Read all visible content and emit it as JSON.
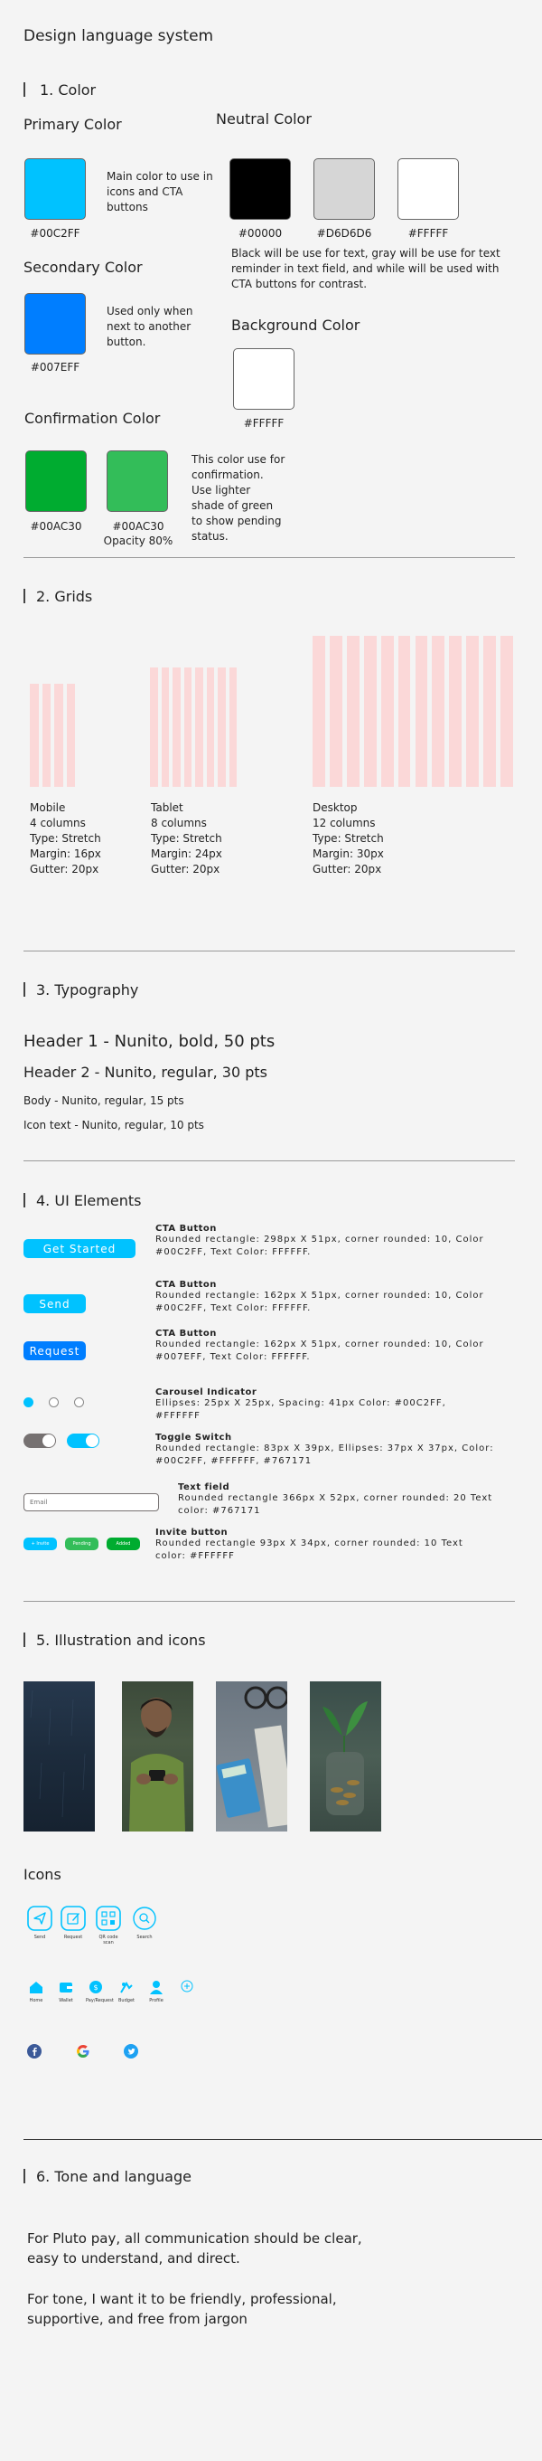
{
  "page_title": "Design language system",
  "color": {
    "section": "1. Color",
    "primary": {
      "title": "Primary Color",
      "hex": "#00C2FF",
      "desc": "Main color to use in icons and CTA buttons",
      "color": "#00C2FF"
    },
    "secondary": {
      "title": "Secondary Color",
      "hex": "#007EFF",
      "desc": "Used only when next to another button.",
      "color": "#007EFF"
    },
    "confirmation": {
      "title": "Confirmation Color",
      "hex1": "#00AC30",
      "hex2": "#00AC30",
      "opacity": "Opacity 80%",
      "desc": "This color use for confirmation. Use lighter shade of green to show pending status.",
      "color1": "#00AC30",
      "color2": "#33BD59"
    },
    "neutral": {
      "title": "Neutral Color",
      "hex1": "#00000",
      "hex2": "#D6D6D6",
      "hex3": "#FFFFF",
      "desc": "Black will be use for text, gray will be use for text reminder in text field, and while will be used with CTA buttons for contrast.",
      "c1": "#000000",
      "c2": "#D6D6D6",
      "c3": "#FFFFFF"
    },
    "background": {
      "title": "Background Color",
      "hex": "#FFFFF",
      "color": "#FFFFFF"
    }
  },
  "grids": {
    "section": "2. Grids",
    "mobile": {
      "name": "Mobile",
      "columns": "4 columns",
      "type": "Type: Stretch",
      "margin": "Margin: 16px",
      "gutter": "Gutter: 20px",
      "count": 4
    },
    "tablet": {
      "name": "Tablet",
      "columns": "8 columns",
      "type": "Type: Stretch",
      "margin": "Margin: 24px",
      "gutter": "Gutter: 20px",
      "count": 8
    },
    "desktop": {
      "name": "Desktop",
      "columns": "12 columns",
      "type": "Type: Stretch",
      "margin": "Margin: 30px",
      "gutter": "Gutter: 20px",
      "count": 12
    }
  },
  "typography": {
    "section": "3. Typography",
    "h1": "Header 1 - Nunito, bold, 50 pts",
    "h2": "Header 2 - Nunito, regular, 30 pts",
    "body": "Body - Nunito, regular, 15 pts",
    "icon": "Icon text - Nunito, regular, 10 pts"
  },
  "ui": {
    "section": "4. UI Elements",
    "cta1": {
      "label": "Get Started",
      "title": "CTA Button",
      "desc": "Rounded rectangle: 298px X 51px, corner rounded: 10, Color #00C2FF, Text Color: FFFFFF."
    },
    "cta2": {
      "label": "Send",
      "title": "CTA Button",
      "desc": "Rounded rectangle: 162px X 51px, corner rounded: 10, Color #00C2FF, Text Color: FFFFFF."
    },
    "cta3": {
      "label": "Request",
      "title": "CTA Button",
      "desc": "Rounded rectangle: 162px X 51px, corner rounded: 10, Color #007EFF, Text Color: FFFFFF."
    },
    "carousel": {
      "title": "Carousel Indicator",
      "desc": "Ellipses: 25px X 25px, Spacing: 41px Color: #00C2FF, #FFFFFF"
    },
    "toggle": {
      "title": "Toggle Switch",
      "desc": "Rounded rectangle: 83px X 39px, Ellipses: 37px X 37px, Color: #00C2FF, #FFFFFF, #767171"
    },
    "textfield": {
      "title": "Text field",
      "desc": "Rounded rectangle 366px X 52px, corner rounded: 20 Text color: #767171",
      "placeholder": "Email"
    },
    "invite": {
      "title": "Invite button",
      "desc": "Rounded rectangle 93px X 34px, corner rounded: 10 Text color: #FFFFFF",
      "b1": "+ Invite",
      "b2": "Pending",
      "b3": "Added"
    }
  },
  "illustration": {
    "section": "5. Illustration and icons",
    "icons_title": "Icons",
    "row1": [
      "Send",
      "Request",
      "QR code scan",
      "Search"
    ],
    "row2": [
      "Home",
      "Wallet",
      "Pay/Request",
      "Budget",
      "Profile"
    ]
  },
  "tone": {
    "section": "6. Tone and language",
    "p1": "For Pluto pay, all communication should be clear, easy to understand, and direct.",
    "p2": "For tone,  I want it to be friendly, professional, supportive, and free from jargon"
  }
}
